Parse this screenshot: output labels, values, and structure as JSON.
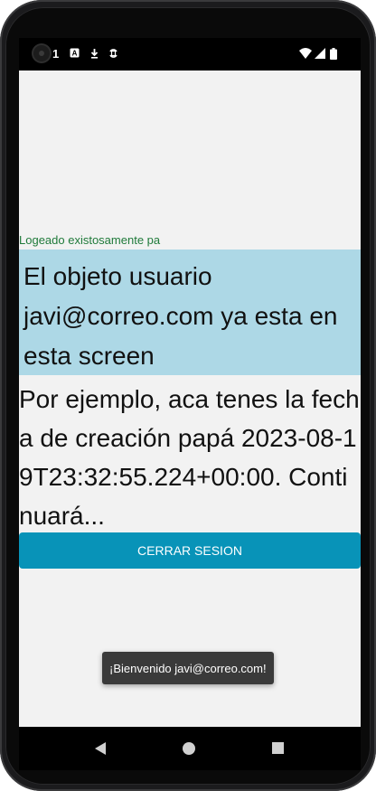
{
  "status_bar": {
    "time": "1",
    "icons": [
      "notification-a-icon",
      "download-icon",
      "sync-icon",
      "wifi-icon",
      "cell-signal-icon",
      "battery-icon"
    ]
  },
  "screen": {
    "login_message": "Logeado existosamente pa",
    "user_info": "El objeto usuario javi@correo.com ya esta en esta screen",
    "creation_info": "Por ejemplo, aca tenes la fecha de creación papá 2023-08-19T23:32:55.224+00:00. Continuará...",
    "logout_button": "CERRAR SESION",
    "toast": "¡Bienvenido javi@correo.com!"
  },
  "colors": {
    "screen_bg": "#f2f2f2",
    "info_box_bg": "#add8e6",
    "button_bg": "#0893b8",
    "success_text": "#1f7a3a"
  },
  "nav": {
    "icons": [
      "back-icon",
      "home-icon",
      "recents-icon"
    ]
  }
}
